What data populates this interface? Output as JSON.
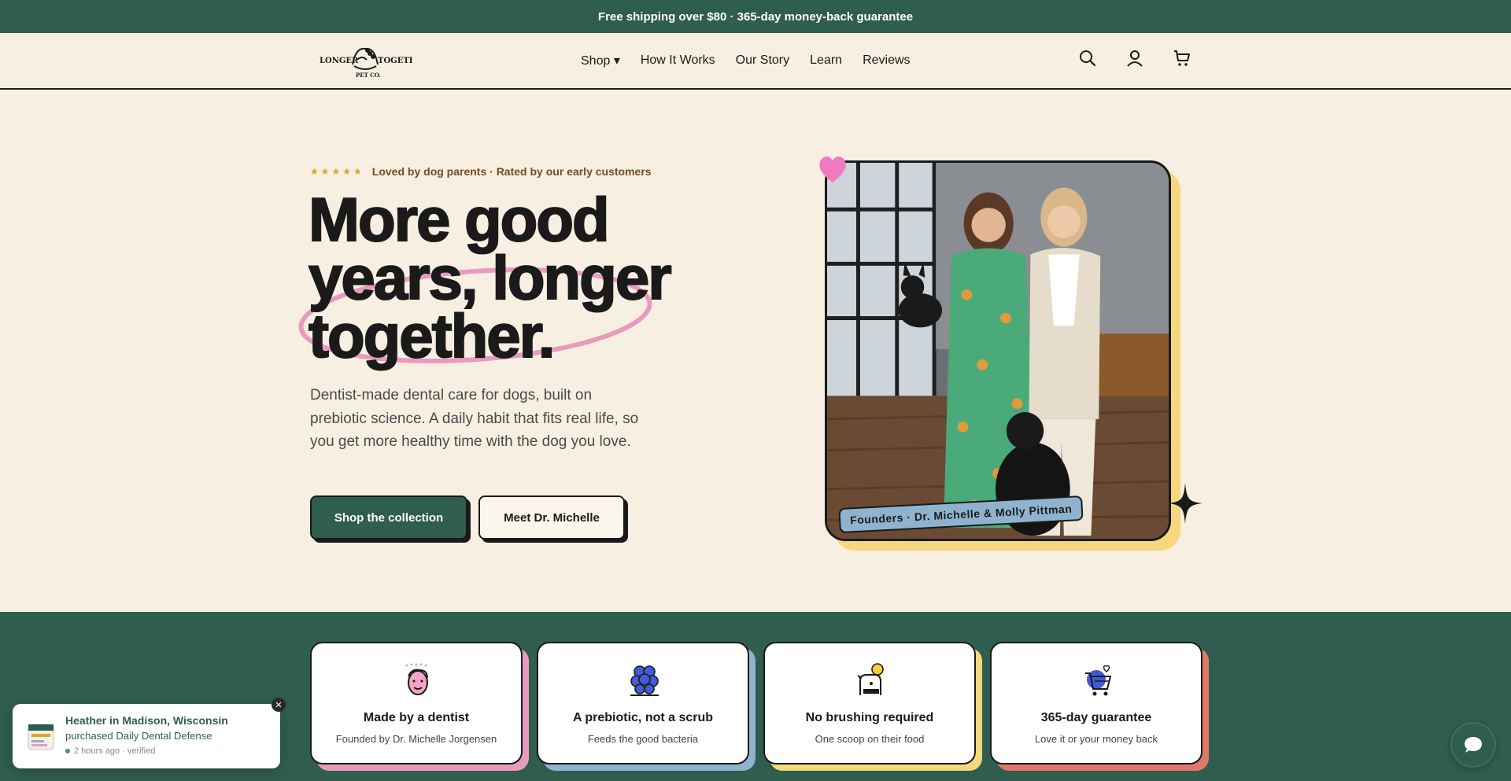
{
  "announcement": "Free shipping over $80 · 365-day money-back guarantee",
  "brand": {
    "logo_left": "LONGER",
    "logo_right": "TOGETHER",
    "logo_sub": "PET CO."
  },
  "nav": {
    "items": [
      "Shop ▾",
      "How It Works",
      "Our Story",
      "Learn",
      "Reviews"
    ]
  },
  "header_icons": [
    "search-icon",
    "account-icon",
    "cart-icon"
  ],
  "hero": {
    "stars": "★★★★★",
    "rating_text": "Loved by dog parents · Rated by our early customers",
    "headline_lines": [
      "More good",
      "years, longer",
      "together."
    ],
    "subtitle": "Dentist-made dental care for dogs, built on prebiotic science. A daily habit that fits real life, so you get more healthy time with the dog you love.",
    "primary_cta": "Shop the collection",
    "secondary_cta": "Meet Dr. Michelle",
    "photo_caption": "Founders · Dr. Michelle & Molly Pittman"
  },
  "features": [
    {
      "title": "Made by a dentist",
      "subtitle": "Founded by Dr. Michelle Jorgensen",
      "icon": "dentist-face-icon",
      "accent": "#e89bbf"
    },
    {
      "title": "A prebiotic, not a scrub",
      "subtitle": "Feeds the good bacteria",
      "icon": "bacteria-icon",
      "accent": "#8fb3cf"
    },
    {
      "title": "No brushing required",
      "subtitle": "One scoop on their food",
      "icon": "dog-scoop-icon",
      "accent": "#f5d77e"
    },
    {
      "title": "365-day guarantee",
      "subtitle": "Love it or your money back",
      "icon": "cart-heart-icon",
      "accent": "#e0786a"
    }
  ],
  "toast": {
    "name": "Heather in Madison, Wisconsin",
    "product": "purchased Daily Dental Defense",
    "time": "2 hours ago · verified",
    "close": "✕"
  },
  "colors": {
    "brand_green": "#2f5d4e",
    "cream": "#f7efe2",
    "pink": "#e89bbf",
    "yellow": "#f5d77e",
    "blue": "#8fb3cf",
    "coral": "#e0786a"
  }
}
